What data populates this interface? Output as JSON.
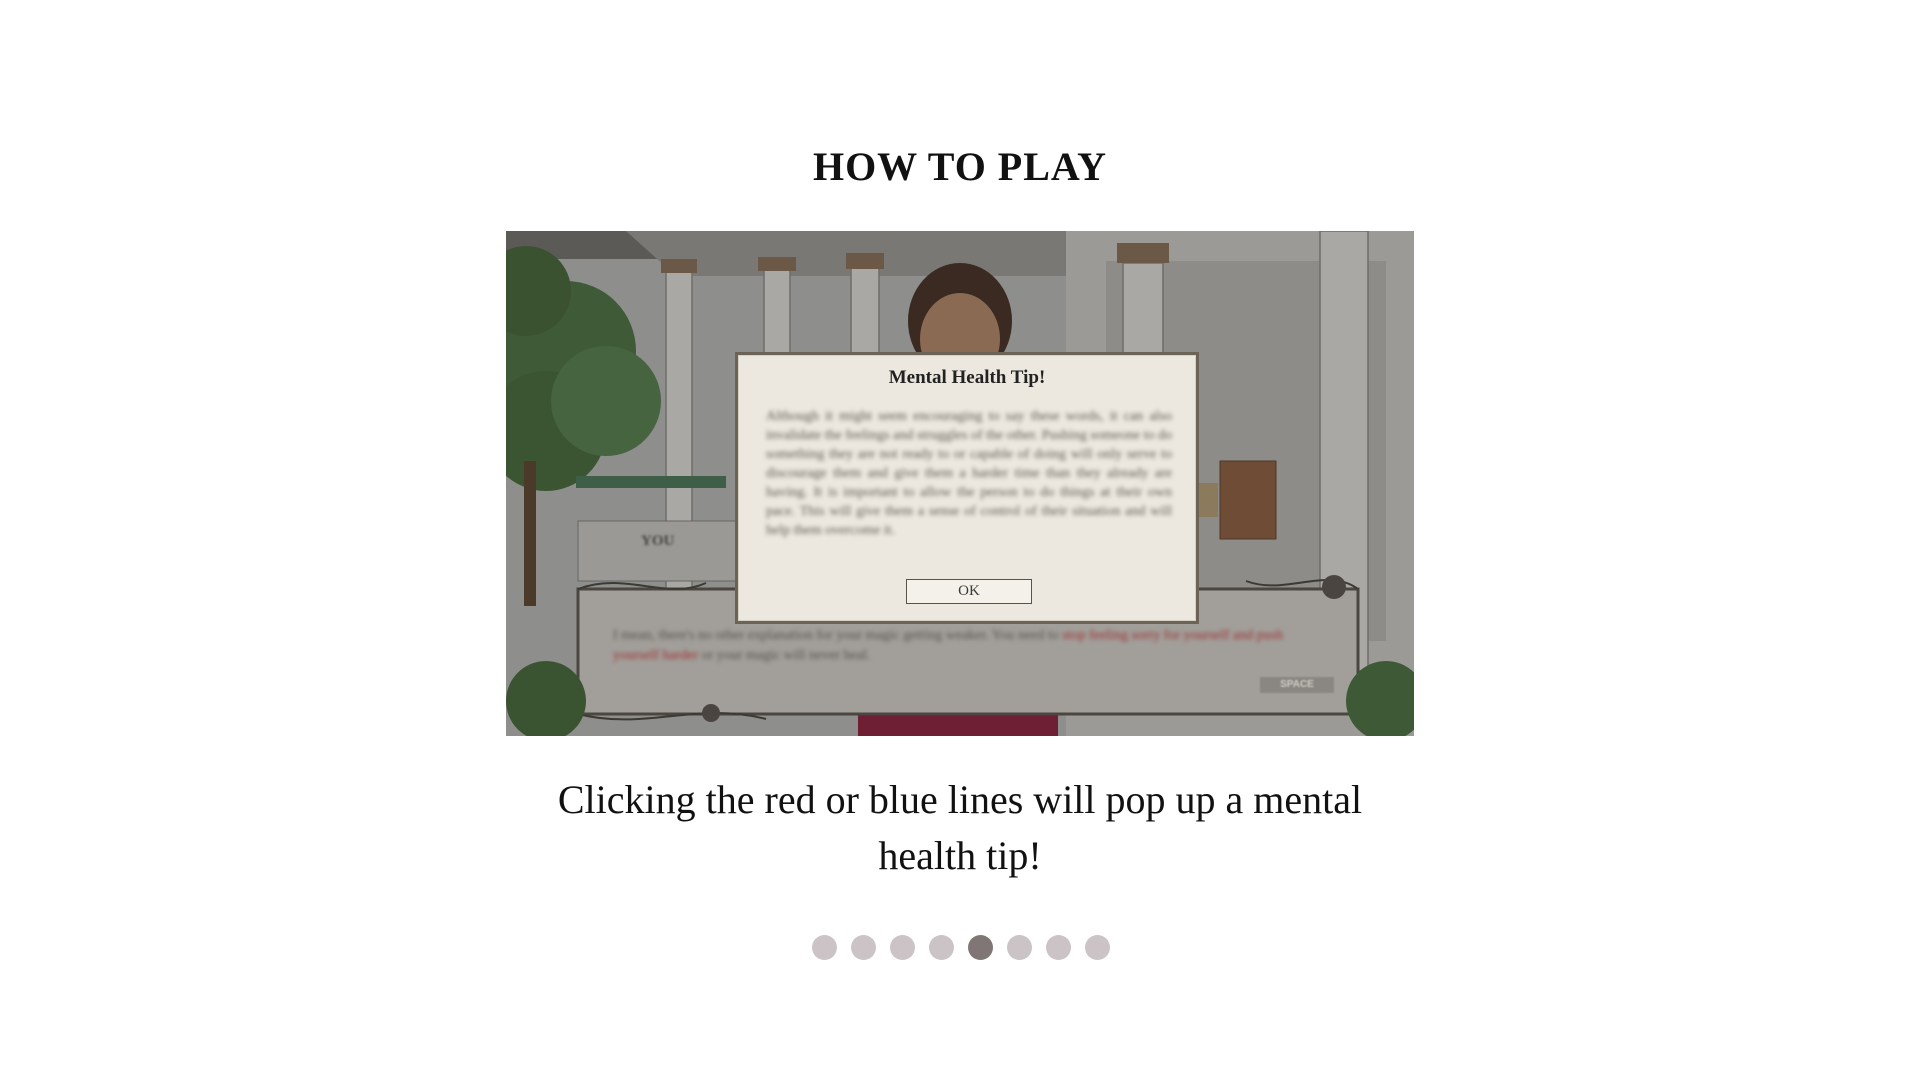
{
  "title": "HOW TO PLAY",
  "screenshot": {
    "tip_title": "Mental Health Tip!",
    "tip_body": "Although it might seem encouraging to say these words, it can also invalidate the feelings and struggles of the other. Pushing someone to do something they are not ready to or capable of doing will only serve to discourage them and give them a harder time than they already are having. It is important to allow the person to do things at their own pace. This will give them a sense of control of their situation and will help them overcome it.",
    "ok_label": "OK",
    "speaker_label": "YOU",
    "dialogue_before": "I mean, there's no other explanation for your magic getting weaker. You need to ",
    "dialogue_highlight": "stop feeling sorry for yourself and push yourself harder",
    "dialogue_after": " or your magic will never heal.",
    "space_label": "SPACE"
  },
  "caption": "Clicking the red or blue lines will pop up a mental health tip!",
  "pagination": {
    "count": 8,
    "active_index": 4
  },
  "colors": {
    "dot_inactive": "#cbc3c5",
    "dot_active": "#807676"
  }
}
